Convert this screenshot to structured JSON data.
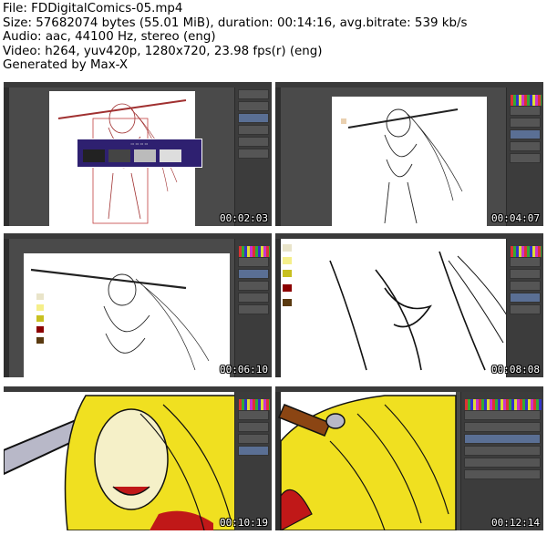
{
  "header": {
    "file": "File: FDDigitalComics-05.mp4",
    "size": "Size: 57682074 bytes (55.01 MiB), duration: 00:14:16, avg.bitrate: 539 kb/s",
    "audio": "Audio: aac, 44100 Hz, stereo (eng)",
    "video": "Video: h264, yuv420p, 1280x720, 23.98 fps(r) (eng)",
    "generated": "Generated by Max-X"
  },
  "thumbnails": [
    {
      "timestamp": "00:02:03"
    },
    {
      "timestamp": "00:04:07"
    },
    {
      "timestamp": "00:06:10"
    },
    {
      "timestamp": "00:08:08"
    },
    {
      "timestamp": "00:10:19"
    },
    {
      "timestamp": "00:12:14"
    }
  ],
  "colors": {
    "app_bg": "#4a4a4a",
    "panel_bg": "#3c3c3c",
    "hair_yellow": "#f0e020",
    "skin": "#f5f0c8",
    "popup_bg": "#2e2070",
    "swatch_1": "#e9e4c9",
    "swatch_2": "#f5ef8a",
    "swatch_3": "#c8c020",
    "swatch_4": "#8b0000",
    "swatch_5": "#5a3a10"
  }
}
